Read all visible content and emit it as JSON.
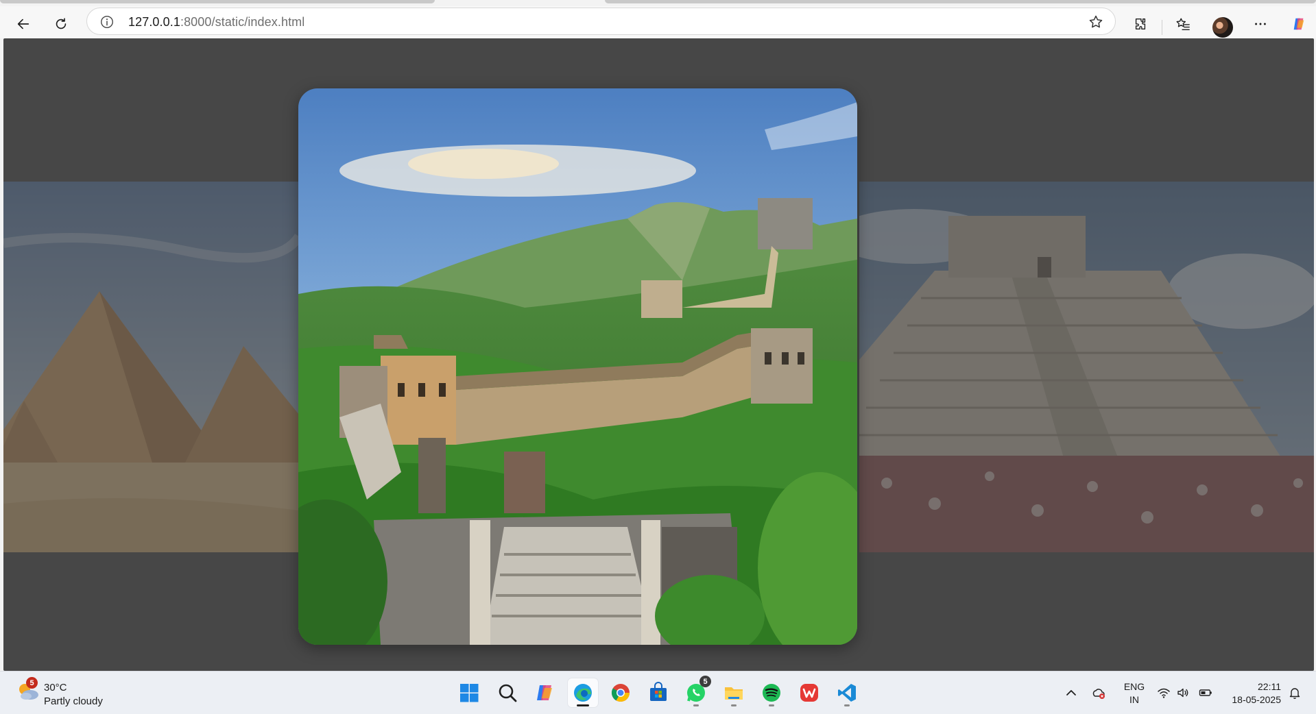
{
  "browser": {
    "url_host": "127.0.0.1",
    "url_path": ":8000/static/index.html",
    "icons": [
      "back-arrow-icon",
      "refresh-icon",
      "site-info-icon",
      "favorite-star-icon",
      "extensions-icon",
      "favorites-icon",
      "profile-avatar",
      "more-icon",
      "copilot-icon"
    ]
  },
  "carousel": {
    "slides": [
      {
        "name": "pyramids-of-giza",
        "position": "left"
      },
      {
        "name": "great-wall-of-china",
        "position": "center",
        "active": true
      },
      {
        "name": "chichen-itza-pyramid",
        "position": "right"
      }
    ],
    "background_color": "#474747"
  },
  "taskbar": {
    "weather": {
      "badge": "5",
      "temp": "30°C",
      "desc": "Partly cloudy"
    },
    "apps": [
      {
        "name": "start",
        "icon": "windows-icon"
      },
      {
        "name": "search",
        "icon": "search-icon"
      },
      {
        "name": "copilot",
        "icon": "copilot-icon"
      },
      {
        "name": "edge",
        "icon": "edge-icon",
        "active": true
      },
      {
        "name": "chrome",
        "icon": "chrome-icon"
      },
      {
        "name": "store",
        "icon": "store-icon"
      },
      {
        "name": "whatsapp",
        "icon": "whatsapp-icon",
        "badge": "5"
      },
      {
        "name": "file-explorer",
        "icon": "folder-icon"
      },
      {
        "name": "spotify",
        "icon": "spotify-icon"
      },
      {
        "name": "wps-office",
        "icon": "wps-icon"
      },
      {
        "name": "vscode",
        "icon": "vscode-icon"
      }
    ],
    "tray": {
      "lang_line1": "ENG",
      "lang_line2": "IN",
      "time": "22:11",
      "date": "18-05-2025"
    }
  }
}
